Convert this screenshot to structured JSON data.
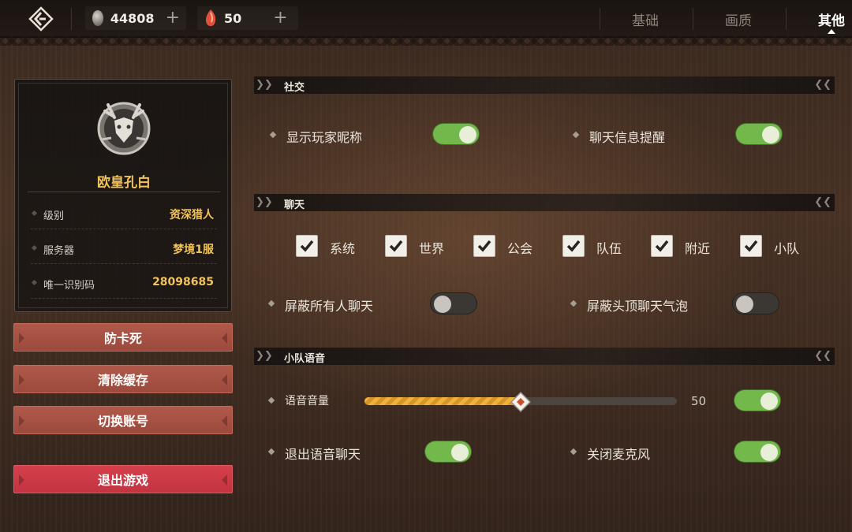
{
  "topbar": {
    "currency_silver": {
      "icon": "silver-coin-icon",
      "value": "44808",
      "plus": "+"
    },
    "currency_gem": {
      "icon": "red-crystal-icon",
      "value": "50",
      "plus": "+"
    },
    "tabs": [
      {
        "label": "基础",
        "active": false
      },
      {
        "label": "画质",
        "active": false
      },
      {
        "label": "其他",
        "active": true
      }
    ]
  },
  "profile": {
    "name": "欧皇孔白",
    "rows": [
      {
        "label": "级别",
        "value": "资深猎人"
      },
      {
        "label": "服务器",
        "value": "梦境1服"
      },
      {
        "label": "唯一识别码",
        "value": "28098685"
      }
    ]
  },
  "buttons": {
    "anti_freeze": "防卡死",
    "clear_cache": "清除缓存",
    "switch_account": "切换账号",
    "exit_game": "退出游戏"
  },
  "sections": {
    "social": {
      "title": "社交",
      "show_nickname": {
        "label": "显示玩家昵称",
        "on": true
      },
      "chat_alert": {
        "label": "聊天信息提醒",
        "on": true
      }
    },
    "chat": {
      "title": "聊天",
      "channels": [
        {
          "label": "系统",
          "checked": true
        },
        {
          "label": "世界",
          "checked": true
        },
        {
          "label": "公会",
          "checked": true
        },
        {
          "label": "队伍",
          "checked": true
        },
        {
          "label": "附近",
          "checked": true
        },
        {
          "label": "小队",
          "checked": true
        }
      ],
      "block_all": {
        "label": "屏蔽所有人聊天",
        "on": false
      },
      "block_bubble": {
        "label": "屏蔽头顶聊天气泡",
        "on": false
      }
    },
    "voice": {
      "title": "小队语音",
      "volume": {
        "label": "语音音量",
        "value": "50",
        "fraction": 0.5,
        "on": true
      },
      "exit_voice": {
        "label": "退出语音聊天",
        "on": true
      },
      "mute_mic": {
        "label": "关闭麦克风",
        "on": true
      }
    }
  },
  "colors": {
    "accent_gold": "#f2c35a",
    "toggle_on": "#72b84a",
    "button_red": "#b0594a",
    "exit_red": "#d4404c"
  }
}
